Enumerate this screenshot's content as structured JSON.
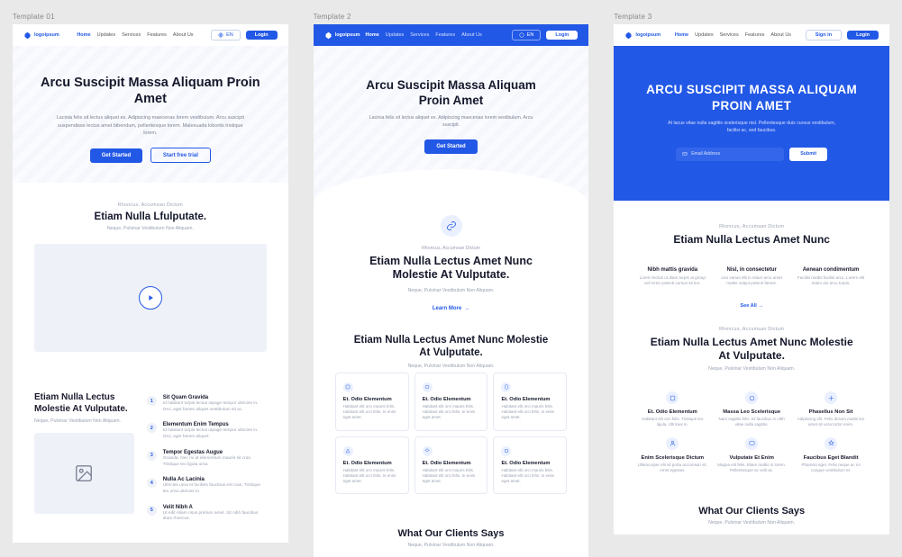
{
  "labels": {
    "t1": "Template 01",
    "t2": "Template 2",
    "t3": "Template 3"
  },
  "nav": {
    "logo": "logoipsum",
    "links": [
      "Home",
      "Updates",
      "Services",
      "Features",
      "About Us"
    ],
    "lang": "EN",
    "login": "Login",
    "signin": "Sign in"
  },
  "t1": {
    "hero_title": "Arcu Suscipit Massa Aliquam Proin Amet",
    "hero_p": "Lacinia felis sit lectus aliquet ex. Adipiscing maecenas lorem vestibulum. Arcu suscipit suspendisse lectus amet bibendum, pellentesque lorem. Malesuada lobortis tristique lorem.",
    "cta1": "Get Started",
    "cta2": "Start free trial",
    "s1_eyebrow": "Rhoncus, Accumsan Dictum",
    "s1_h": "Etiam Nulla Lfulputate.",
    "s1_sub": "Neque, Pulvinar Vestibulum Non Aliquam.",
    "s2_h": "Etiam Nulla Lectus Molestie At Vulputate.",
    "s2_sub": "Neque, Pulvinar Vestibulum Non Aliquam.",
    "steps": [
      {
        "t": "Sit Quam Gravida",
        "d": "Id habitant turpis lectus utpage tempor ultricies in. Orci, eget fames aliquet vestibulum sit ac."
      },
      {
        "t": "Elementum Enim Tempus",
        "d": "Id habitant turpis lectus utpage tempor ultricies in. Orci, eget fames aliquet."
      },
      {
        "t": "Tempor Egestas Augue",
        "d": "Gravida. Nec mi at elementum mauris sit cras. Tristique leo ligula urna."
      },
      {
        "t": "Nulla Ac Lacinia",
        "d": "Ultricies urna et facilisis faucibus est cras. Tristique leo urna ultricies in."
      },
      {
        "t": "Velit Nibh A",
        "d": "Ut edit etiam risus pretium amet. Sit nibh faucibus diam rhoncus."
      }
    ]
  },
  "t2": {
    "hero_title": "Arcu Suscipit Massa Aliquam Proin Amet",
    "hero_p": "Lacinia felis sit lectus aliquet ex. Adipiscing maecenas lorem vestibulum. Arcu suscipit.",
    "cta": "Get Started",
    "eyebrow": "Rhoncus, Accumsan Dictum",
    "h2": "Etiam Nulla Lectus Amet Nunc Molestie At Vulputate.",
    "sub": "Neque, Pulvinar Vestibulum Non Aliquam.",
    "learn": "Learn More",
    "cells": [
      {
        "t": "Et. Odio Elementum",
        "d": "Habitant elit orci mauris felis. Habitant elit orci felis. In enim eget amet."
      },
      {
        "t": "Et. Odio Elementum",
        "d": "Habitant elit orci mauris felis. Habitant elit orci felis. In enim eget amet."
      },
      {
        "t": "Et. Odio Elementum",
        "d": "Habitant elit orci mauris felis. Habitant elit orci felis. In enim eget amet."
      },
      {
        "t": "Et. Odio Elementum",
        "d": "Habitant elit orci mauris felis. Habitant elit orci felis. In enim eget amet."
      },
      {
        "t": "Et. Odio Elementum",
        "d": "Habitant elit orci mauris felis. Habitant elit orci felis. In enim eget amet."
      },
      {
        "t": "Et. Odio Elementum",
        "d": "Habitant elit orci mauris felis. Habitant elit orci felis. In enim eget amet."
      }
    ],
    "clients_h": "What Our Clients Says",
    "clients_sub": "Neque, Pulvinar Vestibulum Non Aliquam."
  },
  "t3": {
    "hero_title": "ARCU SUSCIPIT MASSA ALIQUAM PROIN AMET",
    "hero_p": "At lacus vitae nulla sagittis scelerisque nisl. Pellentesque duis cursus vestibulum, facilisi ac, sed faucibus.",
    "placeholder": "Email Address",
    "submit": "Submit",
    "eyebrow": "Rhoncus, Accumsan Dictum",
    "h2": "Etiam Nulla Lectus Amet Nunc",
    "cols": [
      {
        "t": "Nibh mattis gravida",
        "d": "Lorem lectus ut diam turpis at group vel tortor potenti cursus sit leo."
      },
      {
        "t": "Nisl, in consectetur",
        "d": "Leo varius elit in etiam arcu amet mattis vulput potenti fames."
      },
      {
        "t": "Aenean condimentum",
        "d": "Facilisi mattis facilisi arcu. Lorem elit etiam dui arcu turpis."
      }
    ],
    "seeall": "See All",
    "h2b": "Etiam Nulla Lectus Amet Nunc Molestie At Vulputate.",
    "sub2": "Neque, Pulvinar Vestibulum Non Aliquam.",
    "feats": [
      {
        "t": "Et. Odio Elementum",
        "d": "Habitant elit orci felis. Tristique leo ligula. Ultricies in."
      },
      {
        "t": "Massa Leo Scelerisque",
        "d": "Nam sagittis felis. Et faucibus in nibh vitae nulla sagittis."
      },
      {
        "t": "Phasellus Non Sit",
        "d": "Adipiscing elit. Felis dictum mattis leo amet sit urna tortor enim."
      },
      {
        "t": "Enim Scelerisque Dictum",
        "d": "Ullamcorper elit sit porta accumsan sit. Amet egestas."
      },
      {
        "t": "Vulputate Et Enim",
        "d": "Magna elit felis. Etiam mattis in lorem. Pellentesque ac velit ac."
      },
      {
        "t": "Faucibus Eget Blandit",
        "d": "Pharetra eget. Felis neque ac mi congue vestibulum et."
      }
    ],
    "clients_h": "What Our Clients Says",
    "clients_sub": "Neque, Pulvinar Vestibulum Non Aliquam."
  }
}
